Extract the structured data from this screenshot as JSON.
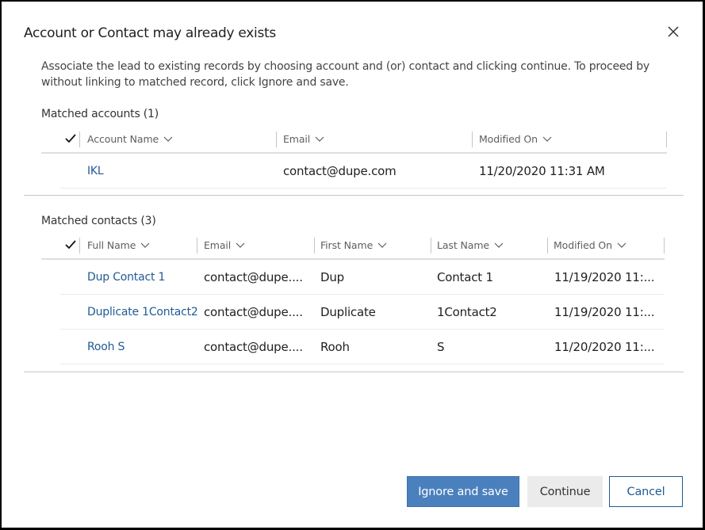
{
  "dialog": {
    "title": "Account or Contact may already exists",
    "description": "Associate the lead to existing records by choosing account and (or) contact and clicking continue. To proceed by without linking to matched record, click Ignore and save."
  },
  "accounts": {
    "section_title": "Matched accounts (1)",
    "columns": [
      "Account Name",
      "Email",
      "Modified On"
    ],
    "rows": [
      {
        "name": "IKL",
        "email": "contact@dupe.com",
        "modified": "11/20/2020 11:31 AM"
      }
    ]
  },
  "contacts": {
    "section_title": "Matched contacts (3)",
    "columns": [
      "Full Name",
      "Email",
      "First Name",
      "Last Name",
      "Modified On"
    ],
    "rows": [
      {
        "full_name": "Dup Contact 1",
        "email": "contact@dupe....",
        "first": "Dup",
        "last": "Contact 1",
        "modified": "11/19/2020 11:..."
      },
      {
        "full_name": "Duplicate 1Contact2",
        "email": "contact@dupe....",
        "first": "Duplicate",
        "last": "1Contact2",
        "modified": "11/19/2020 11:..."
      },
      {
        "full_name": "Rooh S",
        "email": "contact@dupe....",
        "first": "Rooh",
        "last": "S",
        "modified": "11/20/2020 11:..."
      }
    ]
  },
  "buttons": {
    "ignore_save": "Ignore and save",
    "continue": "Continue",
    "cancel": "Cancel"
  },
  "icons": {
    "close": "close-icon",
    "check": "checkmark-icon",
    "chevron": "chevron-down-icon"
  },
  "colors": {
    "link": "#215a95",
    "primary": "#4a80bd",
    "secondary": "#ebebeb"
  }
}
